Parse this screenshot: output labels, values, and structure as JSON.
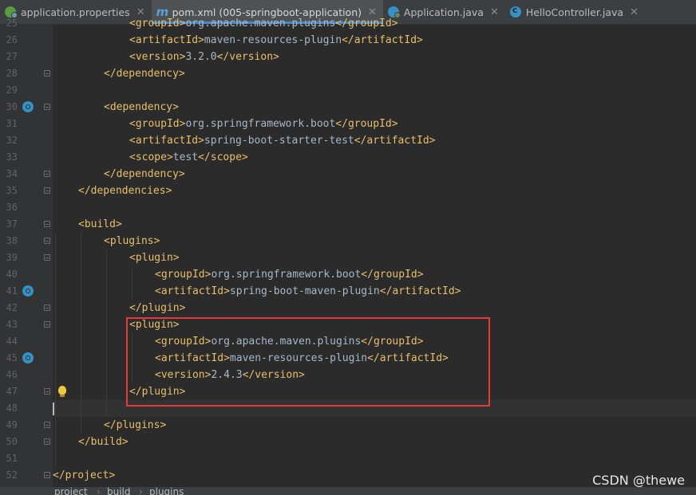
{
  "tabs": [
    {
      "label": "application.properties",
      "icon": "properties-file-icon",
      "active": false
    },
    {
      "label": "pom.xml (005-springboot-application)",
      "icon": "maven-m-icon",
      "active": true
    },
    {
      "label": "Application.java",
      "icon": "spring-class-icon",
      "active": false
    },
    {
      "label": "HelloController.java",
      "icon": "java-class-icon",
      "active": false
    }
  ],
  "lines": [
    {
      "n": "25",
      "indent": 3,
      "open": "<groupId>",
      "text": "org.apache.maven.plugins",
      "close": "</groupId>"
    },
    {
      "n": "26",
      "indent": 3,
      "open": "<artifactId>",
      "text": "maven-resources-plugin",
      "close": "</artifactId>"
    },
    {
      "n": "27",
      "indent": 3,
      "open": "<version>",
      "text": "3.2.0",
      "close": "</version>"
    },
    {
      "n": "28",
      "indent": 2,
      "open": "</dependency>",
      "text": "",
      "close": ""
    },
    {
      "n": "29",
      "indent": 0,
      "open": "",
      "text": "",
      "close": ""
    },
    {
      "n": "30",
      "indent": 2,
      "open": "<dependency>",
      "text": "",
      "close": ""
    },
    {
      "n": "31",
      "indent": 3,
      "open": "<groupId>",
      "text": "org.springframework.boot",
      "close": "</groupId>"
    },
    {
      "n": "32",
      "indent": 3,
      "open": "<artifactId>",
      "text": "spring-boot-starter-test",
      "close": "</artifactId>"
    },
    {
      "n": "33",
      "indent": 3,
      "open": "<scope>",
      "text": "test",
      "close": "</scope>"
    },
    {
      "n": "34",
      "indent": 2,
      "open": "</dependency>",
      "text": "",
      "close": ""
    },
    {
      "n": "35",
      "indent": 1,
      "open": "</dependencies>",
      "text": "",
      "close": ""
    },
    {
      "n": "36",
      "indent": 0,
      "open": "",
      "text": "",
      "close": ""
    },
    {
      "n": "37",
      "indent": 1,
      "open": "<build>",
      "text": "",
      "close": ""
    },
    {
      "n": "38",
      "indent": 2,
      "open": "<plugins>",
      "text": "",
      "close": ""
    },
    {
      "n": "39",
      "indent": 3,
      "open": "<plugin>",
      "text": "",
      "close": ""
    },
    {
      "n": "40",
      "indent": 4,
      "open": "<groupId>",
      "text": "org.springframework.boot",
      "close": "</groupId>"
    },
    {
      "n": "41",
      "indent": 4,
      "open": "<artifactId>",
      "text": "spring-boot-maven-plugin",
      "close": "</artifactId>"
    },
    {
      "n": "42",
      "indent": 3,
      "open": "</plugin>",
      "text": "",
      "close": ""
    },
    {
      "n": "43",
      "indent": 3,
      "open": "<plugin>",
      "text": "",
      "close": ""
    },
    {
      "n": "44",
      "indent": 4,
      "open": "<groupId>",
      "text": "org.apache.maven.plugins",
      "close": "</groupId>"
    },
    {
      "n": "45",
      "indent": 4,
      "open": "<artifactId>",
      "text": "maven-resources-plugin",
      "close": "</artifactId>"
    },
    {
      "n": "46",
      "indent": 4,
      "open": "<version>",
      "text": "2.4.3",
      "close": "</version>"
    },
    {
      "n": "47",
      "indent": 3,
      "open": "</plugin>",
      "text": "",
      "close": ""
    },
    {
      "n": "48",
      "indent": 0,
      "open": "",
      "text": "",
      "close": ""
    },
    {
      "n": "49",
      "indent": 2,
      "open": "</plugins>",
      "text": "",
      "close": ""
    },
    {
      "n": "50",
      "indent": 1,
      "open": "</build>",
      "text": "",
      "close": ""
    },
    {
      "n": "51",
      "indent": 0,
      "open": "",
      "text": "",
      "close": ""
    },
    {
      "n": "52",
      "indent": 0,
      "open": "</project>",
      "text": "",
      "close": ""
    }
  ],
  "fold_markers": [
    "28",
    "30",
    "34",
    "35",
    "37",
    "38",
    "39",
    "42",
    "43",
    "47",
    "49",
    "50",
    "52"
  ],
  "gutter_icons": [
    "30",
    "41",
    "45"
  ],
  "intention_bulb_line": "47",
  "caret_line": "48",
  "highlight_box_lines": [
    "43",
    "47"
  ],
  "breadcrumb": [
    "project",
    "build",
    "plugins"
  ],
  "watermark": "CSDN @thewe",
  "colors": {
    "tag": "#e8bf6a",
    "text": "#a9b7c6",
    "background": "#2b2b2b",
    "highlight_box": "#e03c3c"
  }
}
